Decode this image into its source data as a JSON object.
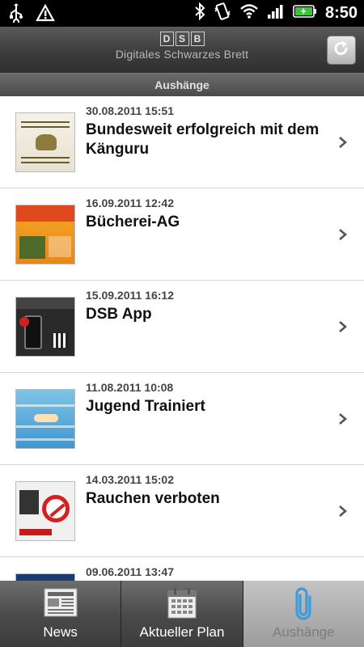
{
  "status_bar": {
    "time": "8:50",
    "icons_left": [
      "usb-icon",
      "warning-icon"
    ],
    "icons_right": [
      "bluetooth-icon",
      "vibrate-icon",
      "wifi-icon",
      "signal-icon",
      "battery-icon"
    ]
  },
  "header": {
    "logo_letters": [
      "D",
      "S",
      "B"
    ],
    "subtitle": "Digitales Schwarzes Brett",
    "refresh_icon": "refresh-icon"
  },
  "section": {
    "title": "Aushänge"
  },
  "items": [
    {
      "date": "30.08.2011 15:51",
      "title": "Bundesweit erfolgreich mit dem Känguru"
    },
    {
      "date": "16.09.2011 12:42",
      "title": "Bücherei-AG"
    },
    {
      "date": "15.09.2011 16:12",
      "title": "DSB App"
    },
    {
      "date": "11.08.2011 10:08",
      "title": "Jugend Trainiert"
    },
    {
      "date": "14.03.2011 15:02",
      "title": "Rauchen verboten"
    },
    {
      "date": "09.06.2011 13:47",
      "title": ""
    }
  ],
  "tabs": [
    {
      "label": "News",
      "icon": "newspaper-icon",
      "selected": false
    },
    {
      "label": "Aktueller Plan",
      "icon": "calendar-icon",
      "selected": false
    },
    {
      "label": "Aushänge",
      "icon": "paperclip-icon",
      "selected": true
    }
  ],
  "colors": {
    "header_bg": "#3d3d3d",
    "list_bg": "#ffffff",
    "selected_tab_bg": "#b0b0b0",
    "paperclip_blue": "#3f9bd9"
  }
}
